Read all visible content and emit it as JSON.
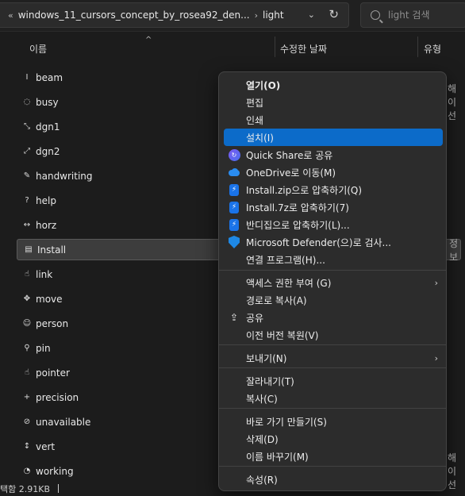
{
  "addressbar": {
    "overflow_label": "«",
    "path": [
      "windows_11_cursors_concept_by_rosea92_den...",
      "light"
    ],
    "search_placeholder": "light 검색",
    "refresh_label": "↻",
    "dropdown_label": "⌄"
  },
  "columns": {
    "name": "이름",
    "modified": "수정한 날짜",
    "type": "유형",
    "sort_indicator": "^"
  },
  "files": [
    {
      "name": "beam",
      "icon": "beam-cursor-icon",
      "glyph": "I"
    },
    {
      "name": "busy",
      "icon": "busy-cursor-icon",
      "glyph": "◌",
      "type_fragment": "해이선"
    },
    {
      "name": "dgn1",
      "icon": "diagonal1-cursor-icon",
      "glyph": "⤡"
    },
    {
      "name": "dgn2",
      "icon": "diagonal2-cursor-icon",
      "glyph": "⤢"
    },
    {
      "name": "handwriting",
      "icon": "pen-cursor-icon",
      "glyph": "✎"
    },
    {
      "name": "help",
      "icon": "help-cursor-icon",
      "glyph": "?"
    },
    {
      "name": "horz",
      "icon": "horizontal-cursor-icon",
      "glyph": "↔"
    },
    {
      "name": "Install",
      "icon": "install-file-icon",
      "glyph": "▤",
      "selected": true,
      "type_fragment": "정보"
    },
    {
      "name": "link",
      "icon": "link-cursor-icon",
      "glyph": "☝"
    },
    {
      "name": "move",
      "icon": "move-cursor-icon",
      "glyph": "✥"
    },
    {
      "name": "person",
      "icon": "person-cursor-icon",
      "glyph": "☺"
    },
    {
      "name": "pin",
      "icon": "pin-cursor-icon",
      "glyph": "⚲"
    },
    {
      "name": "pointer",
      "icon": "pointer-cursor-icon",
      "glyph": "☝"
    },
    {
      "name": "precision",
      "icon": "precision-cursor-icon",
      "glyph": "+"
    },
    {
      "name": "unavailable",
      "icon": "unavailable-cursor-icon",
      "glyph": "⊘"
    },
    {
      "name": "vert",
      "icon": "vertical-cursor-icon",
      "glyph": "↕"
    },
    {
      "name": "working",
      "icon": "working-cursor-icon",
      "glyph": "◔",
      "type_fragment": "해이선"
    }
  ],
  "status": {
    "text": "택함 2.91KB"
  },
  "context_menu": {
    "items": [
      {
        "label": "열기(O)",
        "bold": true
      },
      {
        "label": "편집"
      },
      {
        "label": "인쇄"
      },
      {
        "label": "설치(I)",
        "highlighted": true
      },
      {
        "label": "Quick Share로 공유",
        "icon": "quick-share-icon"
      },
      {
        "label": "OneDrive로 이동(M)",
        "icon": "onedrive-icon"
      },
      {
        "label": "Install.zip으로 압축하기(Q)",
        "icon": "bandizip-icon"
      },
      {
        "label": "Install.7z로 압축하기(7)",
        "icon": "bandizip-icon"
      },
      {
        "label": "반디집으로 압축하기(L)...",
        "icon": "bandizip-icon"
      },
      {
        "label": "Microsoft Defender(으)로 검사...",
        "icon": "defender-shield-icon"
      },
      {
        "label": "연결 프로그램(H)..."
      },
      {
        "label": "액세스 권한 부여 (G)",
        "submenu": true
      },
      {
        "label": "경로로 복사(A)"
      },
      {
        "label": "공유",
        "icon": "share-icon"
      },
      {
        "label": "이전 버전 복원(V)"
      },
      {
        "label": "보내기(N)",
        "submenu": true
      },
      {
        "label": "잘라내기(T)"
      },
      {
        "label": "복사(C)"
      },
      {
        "label": "바로 가기 만들기(S)"
      },
      {
        "label": "삭제(D)"
      },
      {
        "label": "이름 바꾸기(M)"
      },
      {
        "label": "속성(R)"
      }
    ]
  }
}
